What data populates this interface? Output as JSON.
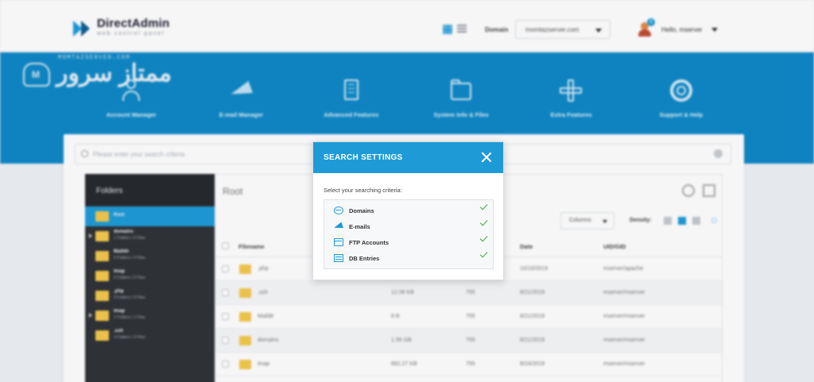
{
  "header": {
    "brand": "DirectAdmin",
    "brand_sub": "web control panel",
    "domain_label": "Domain",
    "domain_value": "momtazserver.com",
    "greeting": "Hello, mserver",
    "notification_count": "1"
  },
  "watermark": {
    "latin": "MOMTAZSERVER.COM",
    "arabic": "ممتاز سرور"
  },
  "menu": [
    {
      "label": "Account Manager",
      "icon": "user-icon"
    },
    {
      "label": "E-mail Manager",
      "icon": "paper-plane-icon"
    },
    {
      "label": "Advanced Features",
      "icon": "document-icon"
    },
    {
      "label": "System Info & Files",
      "icon": "folder-icon"
    },
    {
      "label": "Extra Features",
      "icon": "plus-icon"
    },
    {
      "label": "Support & Help",
      "icon": "lifebuoy-icon"
    }
  ],
  "search": {
    "placeholder": "Please enter your search criteria"
  },
  "file_manager": {
    "folders_title": "Folders",
    "root_title": "Root",
    "columns_button": "Columns",
    "density_label": "Density:",
    "tree": [
      {
        "name": "Root",
        "meta": "",
        "active": true
      },
      {
        "name": "domains",
        "meta": "1 Folders / 0 Files",
        "active": false
      },
      {
        "name": "Maildir",
        "meta": "0 Folders / 0 Files",
        "active": false
      },
      {
        "name": "imap",
        "meta": "0 Folders / 0 Files",
        "active": false
      },
      {
        "name": ".php",
        "meta": "0 Folders / 0 Files",
        "active": false
      },
      {
        "name": "imap",
        "meta": "1 Folders / 1 Files",
        "active": false
      },
      {
        "name": ".ssh",
        "meta": "0 Folders / 0 Files",
        "active": false
      }
    ],
    "columns": [
      "Filename",
      "Date",
      "UID/GID"
    ],
    "rows": [
      {
        "name": ".php",
        "size": "",
        "perm": "",
        "date": "10/10/2019",
        "uid": "mserver/apache"
      },
      {
        "name": ".ssh",
        "size": "12.06 KB",
        "perm": "755",
        "date": "8/21/2019",
        "uid": "mserver/mserver"
      },
      {
        "name": "Maildir",
        "size": "8 B",
        "perm": "755",
        "date": "8/21/2019",
        "uid": "mserver/mserver"
      },
      {
        "name": "domains",
        "size": "1.56 GB",
        "perm": "755",
        "date": "8/21/2019",
        "uid": "mserver/mserver"
      },
      {
        "name": "imap",
        "size": "882.27 KB",
        "perm": "755",
        "date": "8/24/2019",
        "uid": "mserver/mserver"
      }
    ]
  },
  "modal": {
    "title": "SEARCH SETTINGS",
    "subtitle": "Select your searching criteria:",
    "criteria": [
      {
        "label": "Domains",
        "icon": "globe-icon",
        "checked": true
      },
      {
        "label": "E-mails",
        "icon": "paper-plane-icon",
        "checked": true
      },
      {
        "label": "FTP Accounts",
        "icon": "ftp-icon",
        "checked": true
      },
      {
        "label": "DB Entries",
        "icon": "database-icon",
        "checked": true
      }
    ]
  },
  "colors": {
    "accent": "#1e9bd7",
    "header_blue": "#0e88c6",
    "sidebar_dark": "#2f3236",
    "check_green": "#3aa84a",
    "folder_yellow": "#f5c84c"
  }
}
